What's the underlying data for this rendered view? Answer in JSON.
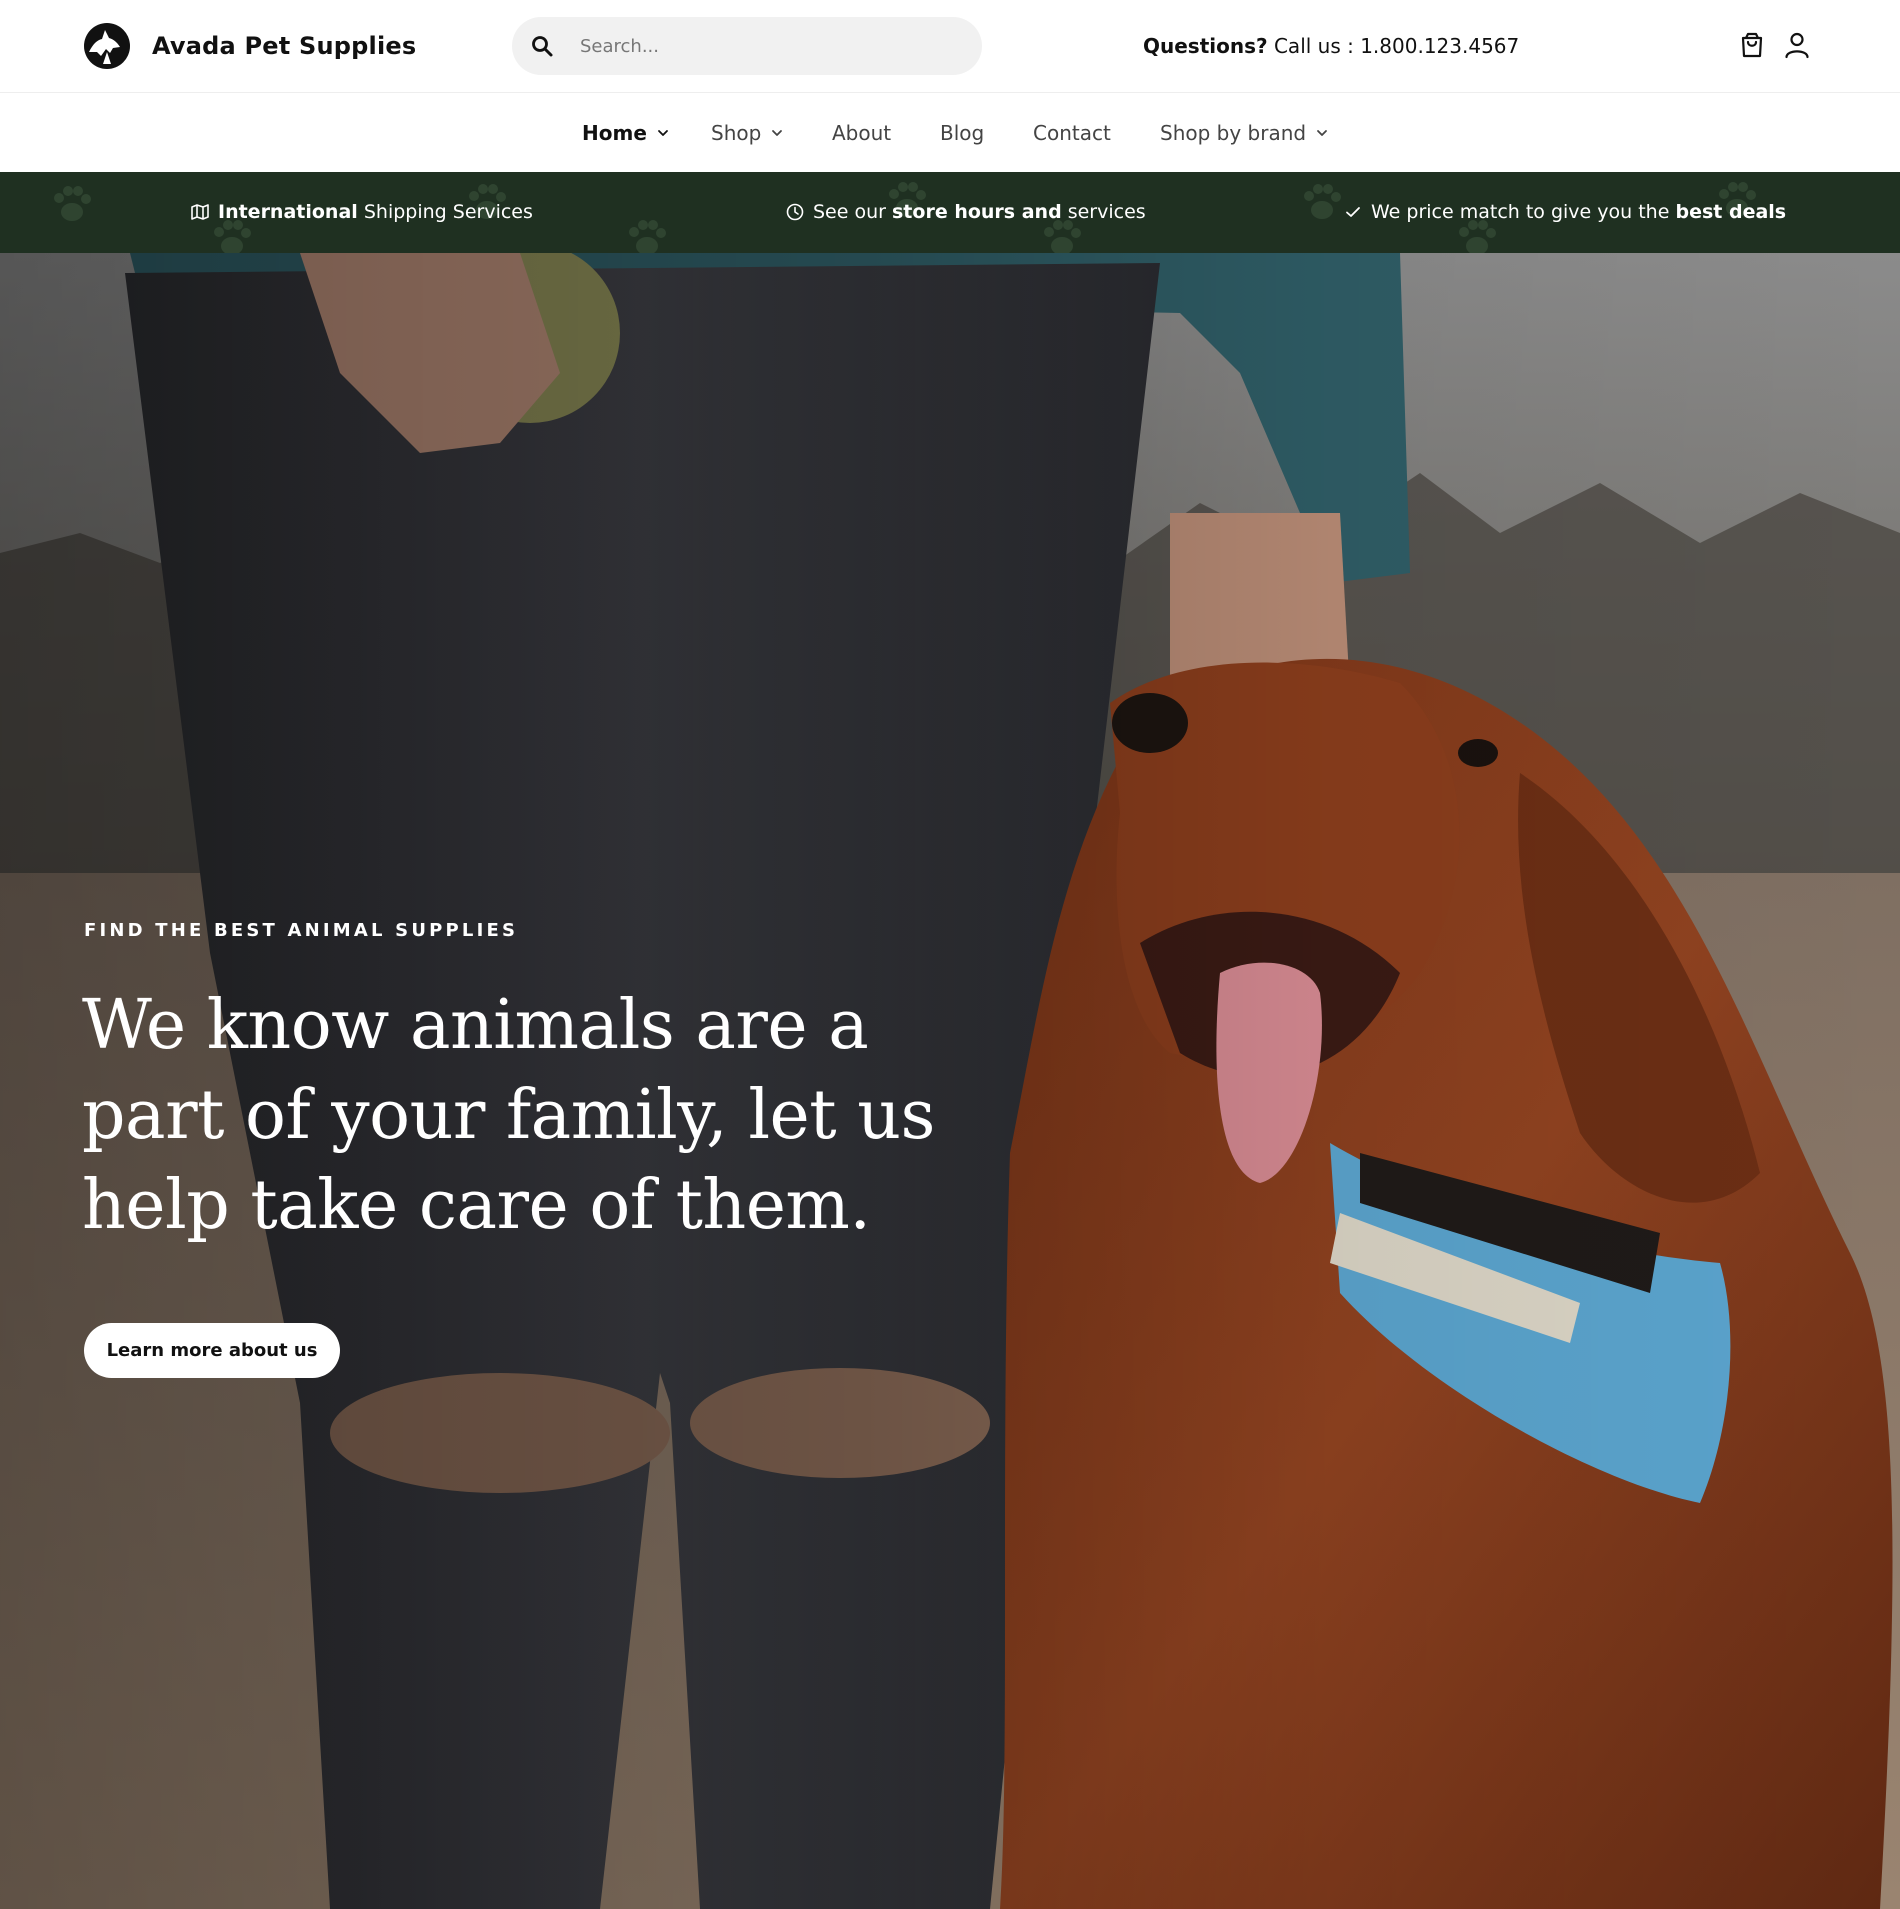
{
  "header": {
    "brand": "Avada Pet Supplies",
    "logo_icon": "dog-silhouette-logo",
    "search": {
      "placeholder": "Search...",
      "value": ""
    },
    "questions_label": "Questions?",
    "call_text": "Call us : 1.800.123.4567",
    "icons": [
      "shopping-bag-icon",
      "user-icon"
    ]
  },
  "nav": {
    "items": [
      {
        "label": "Home",
        "dropdown": true,
        "active": true
      },
      {
        "label": "Shop",
        "dropdown": true,
        "active": false
      },
      {
        "label": "About",
        "dropdown": false,
        "active": false
      },
      {
        "label": "Blog",
        "dropdown": false,
        "active": false
      },
      {
        "label": "Contact",
        "dropdown": false,
        "active": false
      },
      {
        "label": "Shop by brand",
        "dropdown": true,
        "active": false
      }
    ]
  },
  "promo": {
    "background_color": "#1f3021",
    "items": [
      {
        "icon": "map-icon",
        "strong": "International",
        "rest": " Shipping Services"
      },
      {
        "icon": "clock-icon",
        "pre": "See our ",
        "strong": "store hours and",
        "post": " services"
      },
      {
        "icon": "check-icon",
        "pre": "We price match to give you the ",
        "strong": "best deals"
      }
    ]
  },
  "hero": {
    "eyebrow": "FIND THE BEST ANIMAL SUPPLIES",
    "headline": "We know animals are a part of your family, let us help take care of them.",
    "cta_label": "Learn more about us",
    "image_subject": "person in ripped jeans with red setter dog in a field"
  }
}
